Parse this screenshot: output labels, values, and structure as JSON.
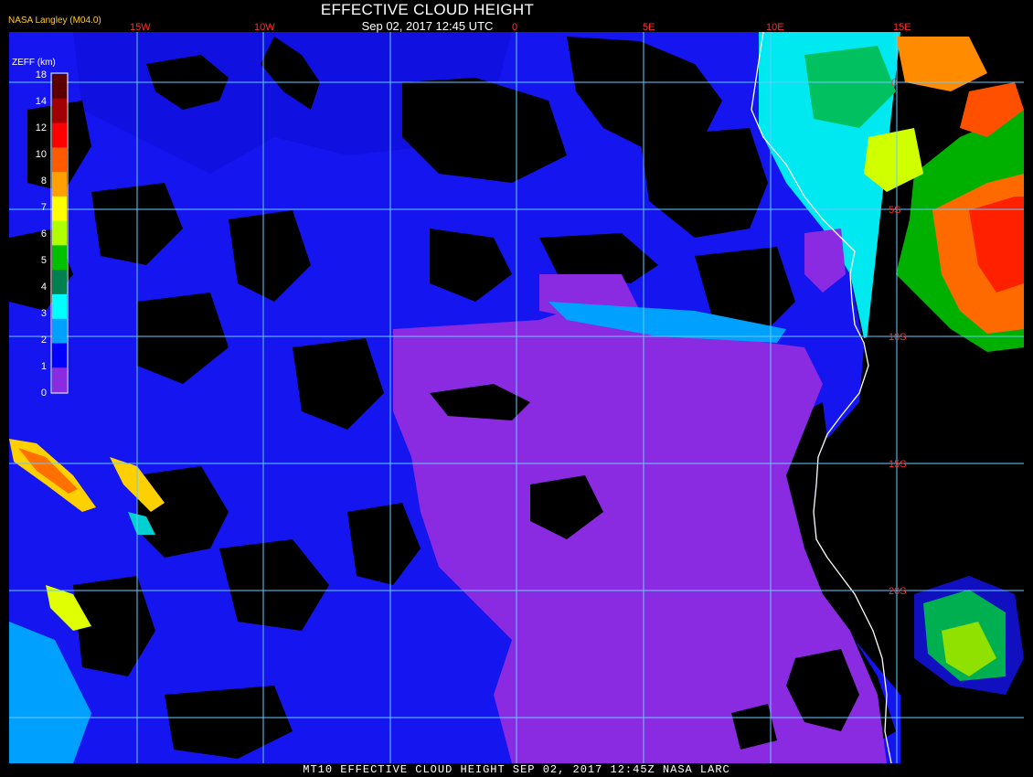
{
  "header": {
    "title": "EFFECTIVE CLOUD HEIGHT",
    "subtitle": "Sep 02, 2017 12:45 UTC",
    "source": "NASA Langley (M04.0)"
  },
  "footer": "MT10  EFFECTIVE CLOUD HEIGHT   SEP 02, 2017 12:45Z   NASA LARC",
  "colorbar": {
    "title": "ZEFF (km)",
    "ticks": [
      "18",
      "14",
      "12",
      "10",
      "8",
      "7",
      "6",
      "5",
      "4",
      "3",
      "2",
      "1",
      "0"
    ],
    "colors": [
      "#5a0000",
      "#a00000",
      "#ff0000",
      "#ff5a00",
      "#ffa000",
      "#ffff00",
      "#b0ff00",
      "#00c000",
      "#008050",
      "#00ffff",
      "#00a0ff",
      "#0000ff",
      "#8a2be2"
    ]
  },
  "grid": {
    "longitude_labels": [
      "15W",
      "10W",
      "0",
      "5E",
      "10E",
      "15E"
    ],
    "latitude_labels": [
      "0",
      "5S",
      "10S",
      "15S",
      "20S"
    ]
  },
  "colors": {
    "background": "#000000",
    "grid": "#66ccff",
    "coast": "#ffffff",
    "grid_label": "#ff3030"
  }
}
